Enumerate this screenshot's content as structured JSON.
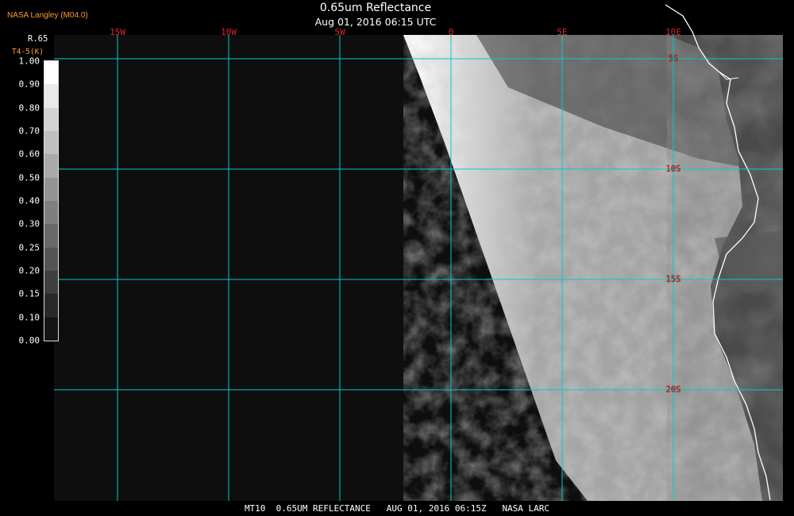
{
  "header": {
    "credit": "NASA Langley (M04.0)",
    "title": "0.65um Reflectance",
    "timestamp": "Aug 01, 2016 06:15 UTC"
  },
  "legend": {
    "variable": "R.65",
    "secondary_variable": "T4-5(K)",
    "ticks": [
      "1.00",
      "0.90",
      "0.80",
      "0.70",
      "0.60",
      "0.50",
      "0.40",
      "0.30",
      "0.25",
      "0.20",
      "0.15",
      "0.10",
      "0.00"
    ],
    "tick_values": [
      1.0,
      0.9,
      0.8,
      0.7,
      0.6,
      0.5,
      0.4,
      0.3,
      0.25,
      0.2,
      0.15,
      0.1,
      0.0
    ]
  },
  "map": {
    "longitude_labels": [
      "15W",
      "10W",
      "5W",
      "0",
      "5E",
      "10E"
    ],
    "longitudes": [
      -15,
      -10,
      -5,
      0,
      5,
      10
    ],
    "latitude_labels": [
      "5S",
      "10S",
      "15S",
      "20S"
    ],
    "latitudes": [
      -5,
      -10,
      -15,
      -20
    ],
    "grid_color": "#00cccc",
    "label_color": "#d9262b"
  },
  "footer": {
    "text": "MT10  0.65UM REFLECTANCE   AUG 01, 2016 06:15Z   NASA LARC"
  }
}
